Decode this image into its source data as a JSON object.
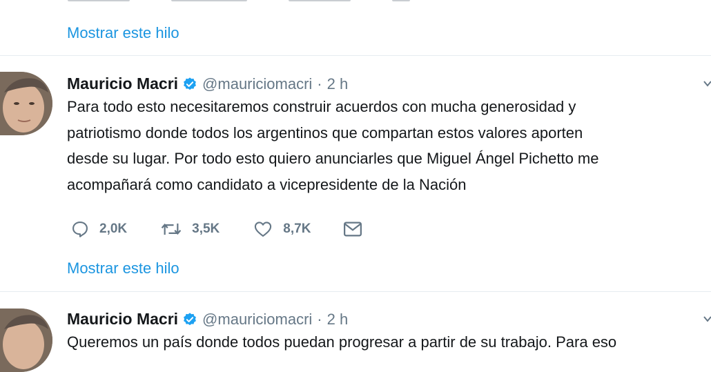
{
  "thread_link_label": "Mostrar este hilo",
  "colors": {
    "link": "#1b95e0",
    "muted": "#657786",
    "text": "#14171a",
    "verified": "#1da1f2",
    "divider": "#e6ecf0"
  },
  "tweets": [
    {
      "author_name": "Mauricio Macri",
      "handle": "@mauriciomacri",
      "separator": "·",
      "time": "2 h",
      "verified_icon": "verified-badge-icon",
      "lines": [
        "Para todo esto necesitaremos construir acuerdos con mucha generosidad y",
        "patriotismo donde todos los argentinos que compartan estos valores aporten",
        "desde su lugar. Por todo esto quiero anunciarles que Miguel Ángel Pichetto me",
        "acompañará como candidato a vicepresidente de la Nación"
      ],
      "actions": {
        "replies": "2,0K",
        "retweets": "3,5K",
        "likes": "8,7K"
      }
    },
    {
      "author_name": "Mauricio Macri",
      "handle": "@mauriciomacri",
      "separator": "·",
      "time": "2 h",
      "verified_icon": "verified-badge-icon",
      "lines": [
        "Queremos un país donde todos puedan progresar a partir de su trabajo. Para eso"
      ]
    }
  ]
}
